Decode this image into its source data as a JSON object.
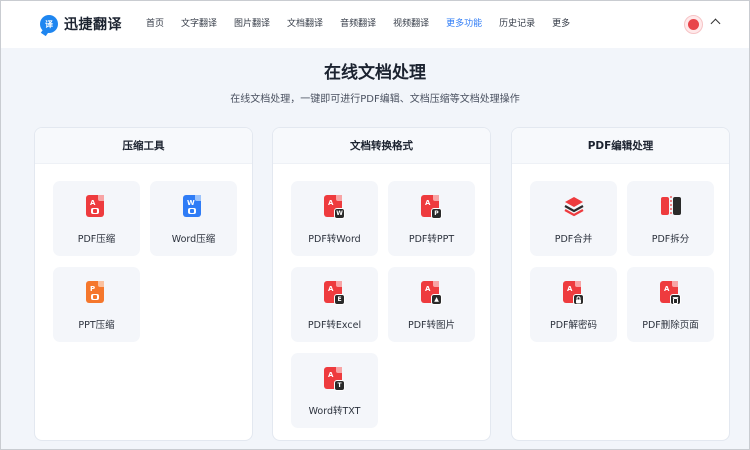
{
  "header": {
    "logo_mark": "译",
    "logo_text": "迅捷翻译",
    "nav": [
      {
        "label": "首页",
        "active": false
      },
      {
        "label": "文字翻译",
        "active": false
      },
      {
        "label": "图片翻译",
        "active": false
      },
      {
        "label": "文档翻译",
        "active": false
      },
      {
        "label": "音频翻译",
        "active": false
      },
      {
        "label": "视频翻译",
        "active": false
      },
      {
        "label": "更多功能",
        "active": true
      },
      {
        "label": "历史记录",
        "active": false
      },
      {
        "label": "更多",
        "active": false
      }
    ]
  },
  "hero": {
    "title": "在线文档处理",
    "subtitle": "在线文档处理，一键即可进行PDF编辑、文档压缩等文档处理操作"
  },
  "cards": [
    {
      "title": "压缩工具",
      "tools": [
        {
          "label": "PDF压缩",
          "icon": "pdf-compress-icon"
        },
        {
          "label": "Word压缩",
          "icon": "word-compress-icon"
        },
        {
          "label": "PPT压缩",
          "icon": "ppt-compress-icon"
        }
      ]
    },
    {
      "title": "文档转换格式",
      "tools": [
        {
          "label": "PDF转Word",
          "icon": "pdf-to-word-icon",
          "badge": "W"
        },
        {
          "label": "PDF转PPT",
          "icon": "pdf-to-ppt-icon",
          "badge": "P"
        },
        {
          "label": "PDF转Excel",
          "icon": "pdf-to-excel-icon",
          "badge": "E"
        },
        {
          "label": "PDF转图片",
          "icon": "pdf-to-image-icon",
          "badge": "▲"
        },
        {
          "label": "Word转TXT",
          "icon": "word-to-txt-icon",
          "badge": "T"
        }
      ]
    },
    {
      "title": "PDF编辑处理",
      "tools": [
        {
          "label": "PDF合并",
          "icon": "pdf-merge-icon"
        },
        {
          "label": "PDF拆分",
          "icon": "pdf-split-icon"
        },
        {
          "label": "PDF解密码",
          "icon": "pdf-unlock-icon"
        },
        {
          "label": "PDF删除页面",
          "icon": "pdf-delete-page-icon"
        }
      ]
    }
  ],
  "colors": {
    "accent": "#2f7cf6",
    "pdf_red": "#ee3b3e",
    "word_blue": "#2f7cf6",
    "ppt_orange": "#f5772c"
  }
}
